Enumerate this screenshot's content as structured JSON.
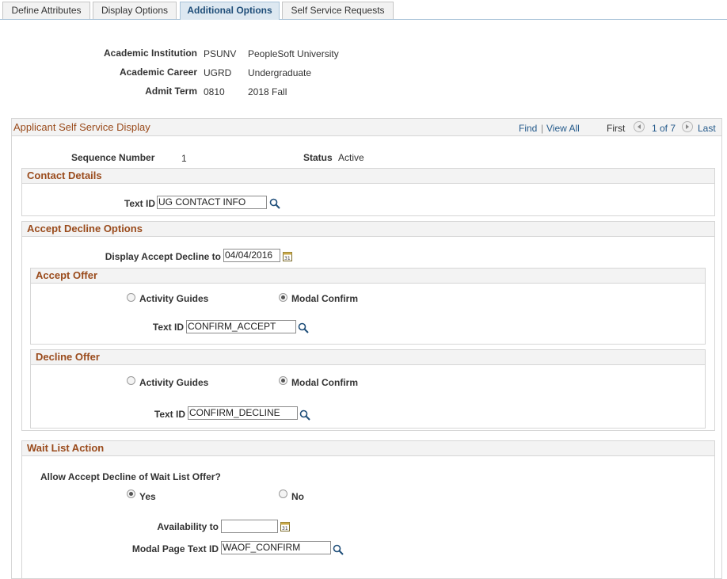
{
  "tabs": [
    "Define Attributes",
    "Display Options",
    "Additional Options",
    "Self Service Requests"
  ],
  "header": {
    "institution_label": "Academic Institution",
    "institution_code": "PSUNV",
    "institution_desc": "PeopleSoft University",
    "career_label": "Academic Career",
    "career_code": "UGRD",
    "career_desc": "Undergraduate",
    "term_label": "Admit Term",
    "term_code": "0810",
    "term_desc": "2018 Fall"
  },
  "grid": {
    "title": "Applicant Self Service Display",
    "find": "Find",
    "sep": "|",
    "view_all": "View All",
    "first": "First",
    "count": "1 of 7",
    "last": "Last"
  },
  "row": {
    "seq_label": "Sequence Number",
    "seq_value": "1",
    "status_label": "Status",
    "status_value": "Active"
  },
  "contact": {
    "title": "Contact Details",
    "text_id_label": "Text ID",
    "text_id_value": "UG CONTACT INFO"
  },
  "accept_decline": {
    "title": "Accept Decline Options",
    "display_label": "Display Accept Decline to",
    "display_value": "04/04/2016",
    "accept": {
      "title": "Accept Offer",
      "opt1": "Activity Guides",
      "opt2": "Modal Confirm",
      "text_id_label": "Text ID",
      "text_id_value": "CONFIRM_ACCEPT",
      "selected": "Modal Confirm"
    },
    "decline": {
      "title": "Decline Offer",
      "opt1": "Activity Guides",
      "opt2": "Modal Confirm",
      "text_id_label": "Text ID",
      "text_id_value": "CONFIRM_DECLINE",
      "selected": "Modal Confirm"
    }
  },
  "waitlist": {
    "title": "Wait List Action",
    "question": "Allow Accept Decline of Wait List Offer?",
    "yes": "Yes",
    "no": "No",
    "selected": "Yes",
    "avail_label": "Availability to",
    "avail_value": "",
    "modal_label": "Modal Page Text ID",
    "modal_value": "WAOF_CONFIRM"
  },
  "icons": {
    "lookup": "magnifier-icon",
    "calendar": "calendar-icon",
    "prev": "prev-arrow-icon",
    "next": "next-arrow-icon"
  }
}
